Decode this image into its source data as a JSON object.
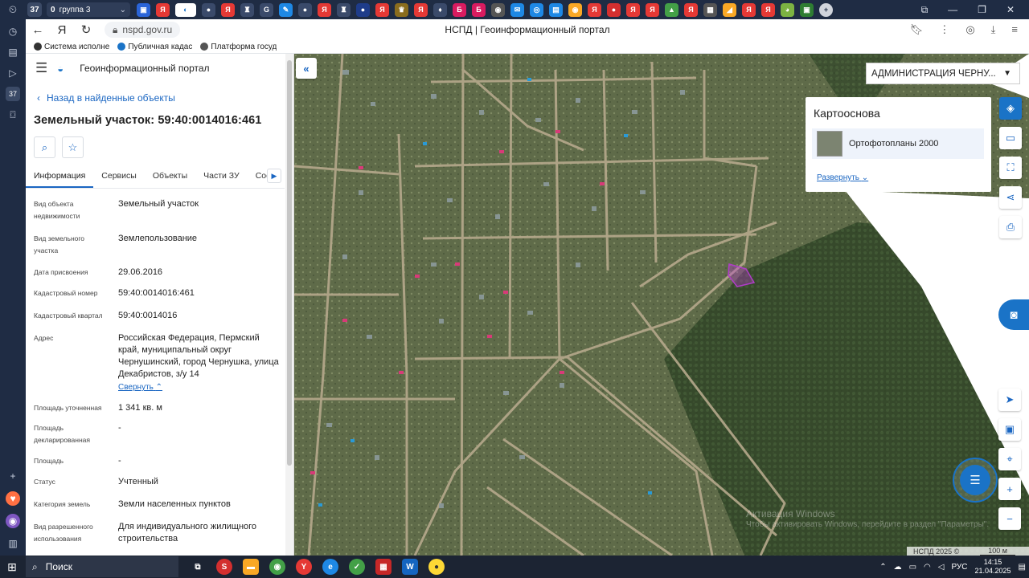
{
  "browser": {
    "tab_counter": "37",
    "tab_group": {
      "count": "0",
      "label": "группа 3"
    },
    "url": "nspd.gov.ru",
    "page_title": "НСПД | Геоинформационный портал",
    "rail_counter": "37"
  },
  "bookmarks": [
    {
      "label": "Система исполне"
    },
    {
      "label": "Публичная кадас"
    },
    {
      "label": "Платформа госуд"
    }
  ],
  "sidebar": {
    "portal_name": "Геоинформационный портал",
    "back_link": "Назад в найденные объекты",
    "title": "Земельный участок: 59:40:0014016:461",
    "tabs": [
      {
        "label": "Информация"
      },
      {
        "label": "Сервисы"
      },
      {
        "label": "Объекты"
      },
      {
        "label": "Части ЗУ"
      },
      {
        "label": "Соста"
      }
    ],
    "properties": [
      {
        "label": "Вид объекта недвижимости",
        "value": "Земельный участок"
      },
      {
        "label": "Вид земельного участка",
        "value": "Землепользование"
      },
      {
        "label": "Дата присвоения",
        "value": "29.06.2016"
      },
      {
        "label": "Кадастровый номер",
        "value": "59:40:0014016:461"
      },
      {
        "label": "Кадастровый квартал",
        "value": "59:40:0014016"
      },
      {
        "label": "Адрес",
        "value": "Российская Федерация, Пермский край, муниципальный округ Чернушинский, город Чернушка, улица Декабристов, з/у 14"
      },
      {
        "label": "Площадь уточненная",
        "value": "1 341 кв. м"
      },
      {
        "label": "Площадь декларированная",
        "value": "-"
      },
      {
        "label": "Площадь",
        "value": "-"
      },
      {
        "label": "Статус",
        "value": "Учтенный"
      },
      {
        "label": "Категория земель",
        "value": "Земли населенных пунктов"
      },
      {
        "label": "Вид разрешенного использования",
        "value": "Для индивидуального жилищного строительства"
      }
    ],
    "collapse_link": "Свернуть"
  },
  "map": {
    "region_select": "АДМИНИСТРАЦИЯ ЧЕРНУ...",
    "basemap_title": "Картооснова",
    "basemap_item": "Ортофотопланы 2000",
    "expand_link": "Развернуть",
    "watermark_line1": "Активация Windows",
    "watermark_line2": "Чтобы активировать Windows, перейдите в раздел \"Параметры\".",
    "copyright": "НСПД 2025 ©",
    "scale": "100 м"
  },
  "taskbar": {
    "search_placeholder": "Поиск",
    "language": "РУС",
    "time": "14:15",
    "date": "21.04.2025"
  }
}
